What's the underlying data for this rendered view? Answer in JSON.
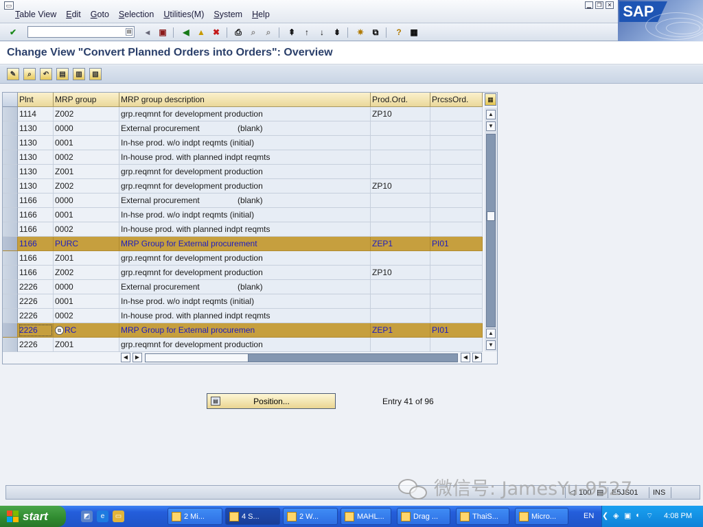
{
  "menu": {
    "items": [
      {
        "pre": "",
        "key": "T",
        "rest": "able View"
      },
      {
        "pre": "",
        "key": "E",
        "rest": "dit"
      },
      {
        "pre": "",
        "key": "G",
        "rest": "oto"
      },
      {
        "pre": "",
        "key": "S",
        "rest": "election"
      },
      {
        "pre": "",
        "key": "U",
        "rest": "tilities(M)"
      },
      {
        "pre": "",
        "key": "S",
        "rest": "ystem"
      },
      {
        "pre": "",
        "key": "H",
        "rest": "elp"
      }
    ],
    "logo": "SAP"
  },
  "page": {
    "title": "Change View \"Convert Planned Orders into Orders\": Overview"
  },
  "table": {
    "headers": [
      "Plnt",
      "MRP group",
      "MRP group description",
      "Prod.Ord.",
      "PrcssOrd."
    ],
    "rows": [
      {
        "plnt": "1114",
        "grp": "Z002",
        "desc": "grp.reqmnt for development production",
        "extra": "",
        "prod": "ZP10",
        "prcss": "",
        "hl": false
      },
      {
        "plnt": "1130",
        "grp": "0000",
        "desc": "External procurement",
        "extra": "(blank)",
        "prod": "",
        "prcss": "",
        "hl": false
      },
      {
        "plnt": "1130",
        "grp": "0001",
        "desc": "In-hse prod. w/o indpt reqmts (initial)",
        "extra": "",
        "prod": "",
        "prcss": "",
        "hl": false
      },
      {
        "plnt": "1130",
        "grp": "0002",
        "desc": "In-house prod. with planned indpt reqmts",
        "extra": "",
        "prod": "",
        "prcss": "",
        "hl": false
      },
      {
        "plnt": "1130",
        "grp": "Z001",
        "desc": "grp.reqmnt for development production",
        "extra": "",
        "prod": "",
        "prcss": "",
        "hl": false
      },
      {
        "plnt": "1130",
        "grp": "Z002",
        "desc": "grp.reqmnt for development production",
        "extra": "",
        "prod": "ZP10",
        "prcss": "",
        "hl": false
      },
      {
        "plnt": "1166",
        "grp": "0000",
        "desc": "External procurement",
        "extra": "(blank)",
        "prod": "",
        "prcss": "",
        "hl": false
      },
      {
        "plnt": "1166",
        "grp": "0001",
        "desc": "In-hse prod. w/o indpt reqmts (initial)",
        "extra": "",
        "prod": "",
        "prcss": "",
        "hl": false
      },
      {
        "plnt": "1166",
        "grp": "0002",
        "desc": "In-house prod. with planned indpt reqmts",
        "extra": "",
        "prod": "",
        "prcss": "",
        "hl": false
      },
      {
        "plnt": "1166",
        "grp": "PURC",
        "desc": "MRP Group for External procurement",
        "extra": "",
        "prod": "ZEP1",
        "prcss": "PI01",
        "hl": true
      },
      {
        "plnt": "1166",
        "grp": "Z001",
        "desc": "grp.reqmnt for development production",
        "extra": "",
        "prod": "",
        "prcss": "",
        "hl": false
      },
      {
        "plnt": "1166",
        "grp": "Z002",
        "desc": "grp.reqmnt for development production",
        "extra": "",
        "prod": "ZP10",
        "prcss": "",
        "hl": false
      },
      {
        "plnt": "2226",
        "grp": "0000",
        "desc": "External procurement",
        "extra": "(blank)",
        "prod": "",
        "prcss": "",
        "hl": false
      },
      {
        "plnt": "2226",
        "grp": "0001",
        "desc": "In-hse prod. w/o indpt reqmts (initial)",
        "extra": "",
        "prod": "",
        "prcss": "",
        "hl": false
      },
      {
        "plnt": "2226",
        "grp": "0002",
        "desc": "In-house prod. with planned indpt reqmts",
        "extra": "",
        "prod": "",
        "prcss": "",
        "hl": false
      },
      {
        "plnt": "2226",
        "grp": "RC",
        "desc": "MRP Group for External procuremen",
        "extra": "",
        "prod": "ZEP1",
        "prcss": "PI01",
        "hl": true
      },
      {
        "plnt": "2226",
        "grp": "Z001",
        "desc": "grp.reqmnt for development production",
        "extra": "",
        "prod": "",
        "prcss": "",
        "hl": false
      }
    ]
  },
  "footer": {
    "position_label": "Position...",
    "entry_text": "Entry 41 of 96"
  },
  "status": {
    "client": "100",
    "server": "E5JS01",
    "mode": "INS"
  },
  "watermark": "微信号: JamesYu-9527",
  "taskbar": {
    "start_label": "start",
    "buttons": [
      "2 Mi...",
      "4 S...",
      "2 W...",
      "MAHL...",
      "Drag ...",
      "ThaiS...",
      "Micro..."
    ],
    "language": "EN",
    "clock": "4:08 PM"
  }
}
